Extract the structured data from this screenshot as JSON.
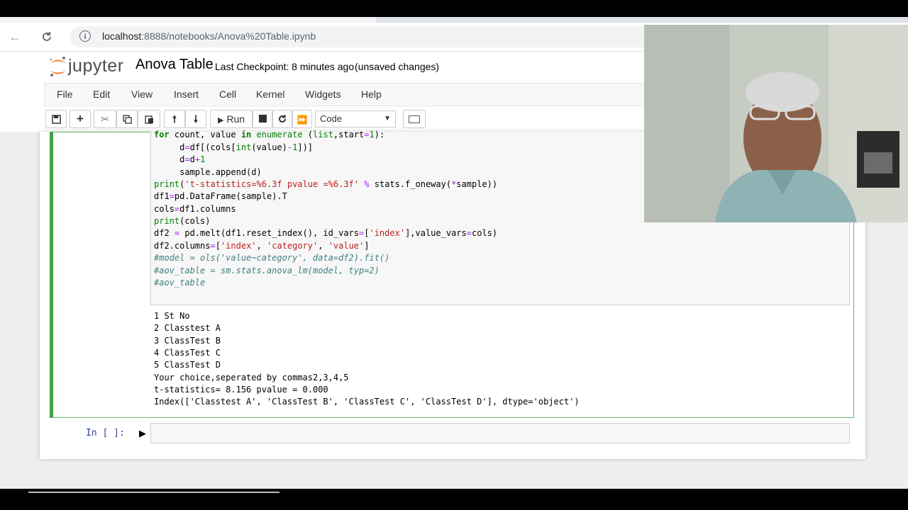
{
  "browser": {
    "url_host": "localhost",
    "url_rest": ":8888/notebooks/Anova%20Table.ipynb",
    "back_icon": "arrow-left-icon",
    "reload_icon": "reload-icon",
    "info_icon": "info-icon"
  },
  "jupyter": {
    "logo_text": "jupyter",
    "notebook_title": "Anova Table",
    "checkpoint": "Last Checkpoint: 8 minutes ago",
    "status": "(unsaved changes)"
  },
  "menu": [
    "File",
    "Edit",
    "View",
    "Insert",
    "Cell",
    "Kernel",
    "Widgets",
    "Help"
  ],
  "toolbar": {
    "run_label": "Run",
    "cell_type": "Code"
  },
  "code_lines": [
    "for count, value in enumerate (list,start=1):",
    "     d=df[(cols[int(value)-1])]",
    "     d=d+1",
    "     sample.append(d)",
    "print('t-statistics=%6.3f pvalue =%6.3f' % stats.f_oneway(*sample))",
    "df1=pd.DataFrame(sample).T",
    "cols=df1.columns",
    "print(cols)",
    "df2 = pd.melt(df1.reset_index(), id_vars=['index'],value_vars=cols)",
    "df2.columns=['index', 'category', 'value']",
    "#model = ols('value~category', data=df2).fit()",
    "#aov_table = sm.stats.anova_lm(model, typ=2)",
    "#aov_table"
  ],
  "output_lines": [
    "1 St No",
    "2 Classtest A",
    "3 ClassTest B",
    "4 ClassTest C",
    "5 ClassTest D",
    "Your choice,seperated by commas2,3,4,5",
    "t-statistics= 8.156 pvalue = 0.000",
    "Index(['Classtest A', 'ClassTest B', 'ClassTest C', 'ClassTest D'], dtype='object')"
  ],
  "next_prompt": "In [ ]:",
  "colors": {
    "selected_cell_border": "#42a047",
    "prompt": "#303f9f"
  }
}
